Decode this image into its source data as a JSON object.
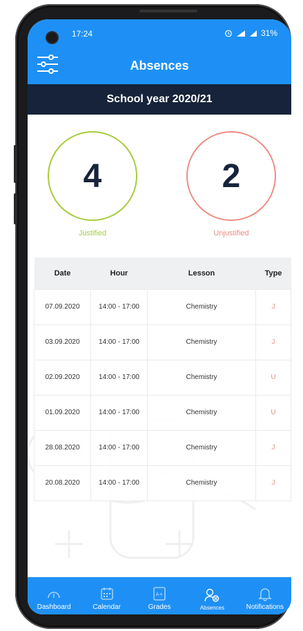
{
  "status_bar": {
    "time": "17:24",
    "battery": "31%"
  },
  "header": {
    "title": "Absences"
  },
  "year_bar": {
    "label": "School year 2020/21"
  },
  "stats": {
    "justified": {
      "count": "4",
      "label": "Justified",
      "color": "#a4cd39"
    },
    "unjustified": {
      "count": "2",
      "label": "Unjustified",
      "color": "#f08b84"
    }
  },
  "table": {
    "headers": [
      "Date",
      "Hour",
      "Lesson",
      "Type"
    ],
    "rows": [
      [
        "07.09.2020",
        "14:00 - 17:00",
        "Chemistry",
        "J"
      ],
      [
        "03.09.2020",
        "14:00 - 17:00",
        "Chemistry",
        "J"
      ],
      [
        "02.09.2020",
        "14:00 - 17:00",
        "Chemistry",
        "U"
      ],
      [
        "01.09.2020",
        "14:00 - 17:00",
        "Chemistry",
        "U"
      ],
      [
        "28.08.2020",
        "14:00 - 17:00",
        "Chemistry",
        "J"
      ],
      [
        "20.08.2020",
        "14:00 - 17:00",
        "Chemistry",
        "J"
      ]
    ]
  },
  "bottom_nav": [
    {
      "label": "Dashboard",
      "icon": "gauge-icon"
    },
    {
      "label": "Calendar",
      "icon": "calendar-icon"
    },
    {
      "label": "Grades",
      "icon": "grades-icon"
    },
    {
      "label": "Absences",
      "icon": "absences-icon",
      "active": true
    },
    {
      "label": "Notifications",
      "icon": "bell-icon"
    }
  ],
  "colors": {
    "primary": "#1e90f5",
    "dark": "#16233a"
  }
}
